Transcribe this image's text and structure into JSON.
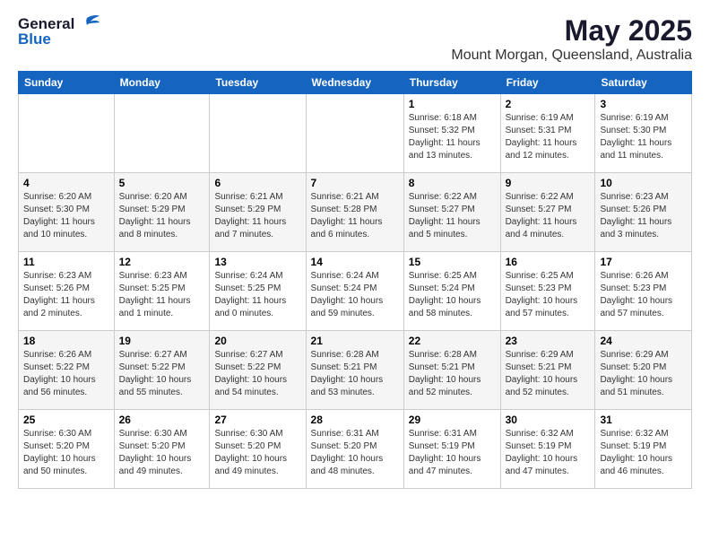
{
  "header": {
    "logo_general": "General",
    "logo_blue": "Blue",
    "month": "May 2025",
    "location": "Mount Morgan, Queensland, Australia"
  },
  "weekdays": [
    "Sunday",
    "Monday",
    "Tuesday",
    "Wednesday",
    "Thursday",
    "Friday",
    "Saturday"
  ],
  "weeks": [
    [
      {
        "day": "",
        "info": ""
      },
      {
        "day": "",
        "info": ""
      },
      {
        "day": "",
        "info": ""
      },
      {
        "day": "",
        "info": ""
      },
      {
        "day": "1",
        "info": "Sunrise: 6:18 AM\nSunset: 5:32 PM\nDaylight: 11 hours\nand 13 minutes."
      },
      {
        "day": "2",
        "info": "Sunrise: 6:19 AM\nSunset: 5:31 PM\nDaylight: 11 hours\nand 12 minutes."
      },
      {
        "day": "3",
        "info": "Sunrise: 6:19 AM\nSunset: 5:30 PM\nDaylight: 11 hours\nand 11 minutes."
      }
    ],
    [
      {
        "day": "4",
        "info": "Sunrise: 6:20 AM\nSunset: 5:30 PM\nDaylight: 11 hours\nand 10 minutes."
      },
      {
        "day": "5",
        "info": "Sunrise: 6:20 AM\nSunset: 5:29 PM\nDaylight: 11 hours\nand 8 minutes."
      },
      {
        "day": "6",
        "info": "Sunrise: 6:21 AM\nSunset: 5:29 PM\nDaylight: 11 hours\nand 7 minutes."
      },
      {
        "day": "7",
        "info": "Sunrise: 6:21 AM\nSunset: 5:28 PM\nDaylight: 11 hours\nand 6 minutes."
      },
      {
        "day": "8",
        "info": "Sunrise: 6:22 AM\nSunset: 5:27 PM\nDaylight: 11 hours\nand 5 minutes."
      },
      {
        "day": "9",
        "info": "Sunrise: 6:22 AM\nSunset: 5:27 PM\nDaylight: 11 hours\nand 4 minutes."
      },
      {
        "day": "10",
        "info": "Sunrise: 6:23 AM\nSunset: 5:26 PM\nDaylight: 11 hours\nand 3 minutes."
      }
    ],
    [
      {
        "day": "11",
        "info": "Sunrise: 6:23 AM\nSunset: 5:26 PM\nDaylight: 11 hours\nand 2 minutes."
      },
      {
        "day": "12",
        "info": "Sunrise: 6:23 AM\nSunset: 5:25 PM\nDaylight: 11 hours\nand 1 minute."
      },
      {
        "day": "13",
        "info": "Sunrise: 6:24 AM\nSunset: 5:25 PM\nDaylight: 11 hours\nand 0 minutes."
      },
      {
        "day": "14",
        "info": "Sunrise: 6:24 AM\nSunset: 5:24 PM\nDaylight: 10 hours\nand 59 minutes."
      },
      {
        "day": "15",
        "info": "Sunrise: 6:25 AM\nSunset: 5:24 PM\nDaylight: 10 hours\nand 58 minutes."
      },
      {
        "day": "16",
        "info": "Sunrise: 6:25 AM\nSunset: 5:23 PM\nDaylight: 10 hours\nand 57 minutes."
      },
      {
        "day": "17",
        "info": "Sunrise: 6:26 AM\nSunset: 5:23 PM\nDaylight: 10 hours\nand 57 minutes."
      }
    ],
    [
      {
        "day": "18",
        "info": "Sunrise: 6:26 AM\nSunset: 5:22 PM\nDaylight: 10 hours\nand 56 minutes."
      },
      {
        "day": "19",
        "info": "Sunrise: 6:27 AM\nSunset: 5:22 PM\nDaylight: 10 hours\nand 55 minutes."
      },
      {
        "day": "20",
        "info": "Sunrise: 6:27 AM\nSunset: 5:22 PM\nDaylight: 10 hours\nand 54 minutes."
      },
      {
        "day": "21",
        "info": "Sunrise: 6:28 AM\nSunset: 5:21 PM\nDaylight: 10 hours\nand 53 minutes."
      },
      {
        "day": "22",
        "info": "Sunrise: 6:28 AM\nSunset: 5:21 PM\nDaylight: 10 hours\nand 52 minutes."
      },
      {
        "day": "23",
        "info": "Sunrise: 6:29 AM\nSunset: 5:21 PM\nDaylight: 10 hours\nand 52 minutes."
      },
      {
        "day": "24",
        "info": "Sunrise: 6:29 AM\nSunset: 5:20 PM\nDaylight: 10 hours\nand 51 minutes."
      }
    ],
    [
      {
        "day": "25",
        "info": "Sunrise: 6:30 AM\nSunset: 5:20 PM\nDaylight: 10 hours\nand 50 minutes."
      },
      {
        "day": "26",
        "info": "Sunrise: 6:30 AM\nSunset: 5:20 PM\nDaylight: 10 hours\nand 49 minutes."
      },
      {
        "day": "27",
        "info": "Sunrise: 6:30 AM\nSunset: 5:20 PM\nDaylight: 10 hours\nand 49 minutes."
      },
      {
        "day": "28",
        "info": "Sunrise: 6:31 AM\nSunset: 5:20 PM\nDaylight: 10 hours\nand 48 minutes."
      },
      {
        "day": "29",
        "info": "Sunrise: 6:31 AM\nSunset: 5:19 PM\nDaylight: 10 hours\nand 47 minutes."
      },
      {
        "day": "30",
        "info": "Sunrise: 6:32 AM\nSunset: 5:19 PM\nDaylight: 10 hours\nand 47 minutes."
      },
      {
        "day": "31",
        "info": "Sunrise: 6:32 AM\nSunset: 5:19 PM\nDaylight: 10 hours\nand 46 minutes."
      }
    ]
  ]
}
